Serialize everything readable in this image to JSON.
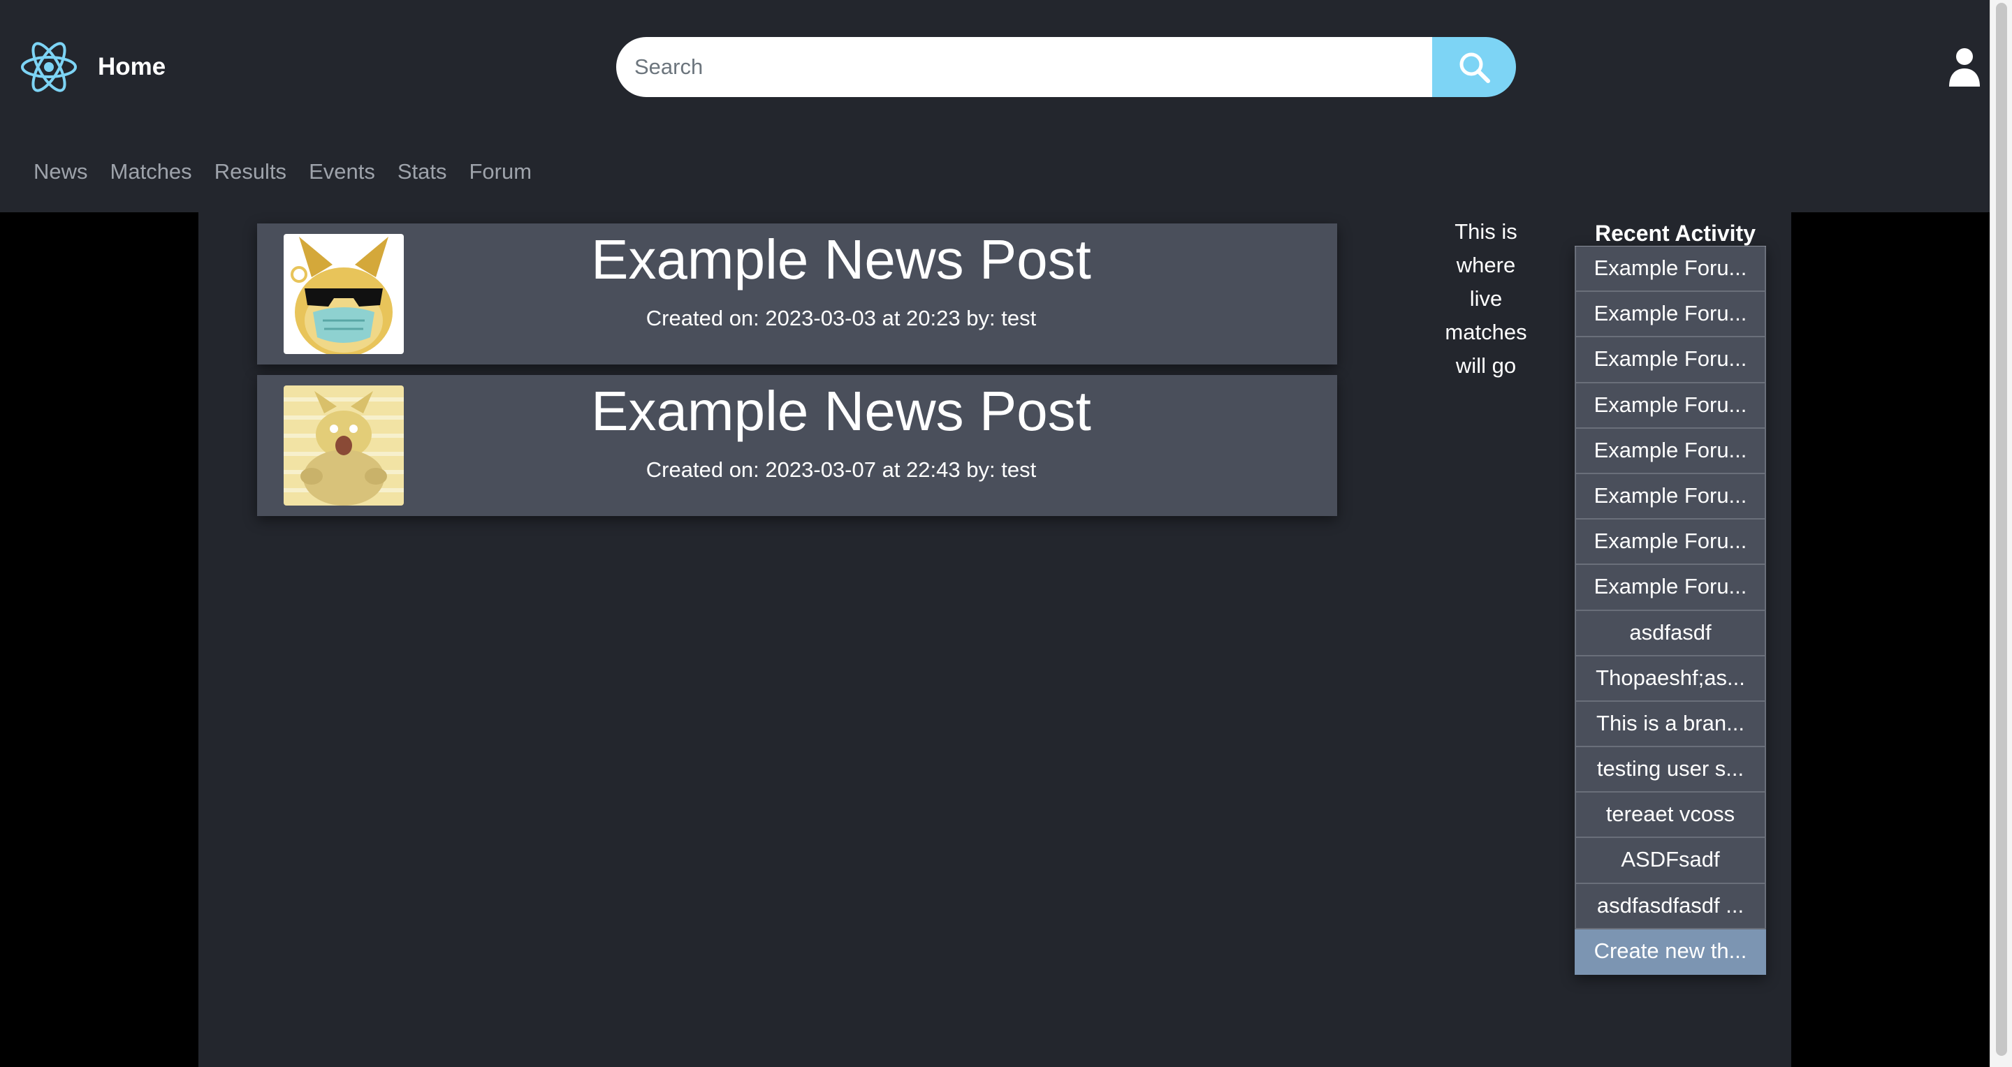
{
  "header": {
    "logo_icon": "react-atom-icon",
    "title": "Home",
    "search": {
      "placeholder": "Search",
      "value": "",
      "button_icon": "search-icon"
    },
    "user_icon": "user-icon"
  },
  "nav": {
    "items": [
      {
        "label": "News"
      },
      {
        "label": "Matches"
      },
      {
        "label": "Results"
      },
      {
        "label": "Events"
      },
      {
        "label": "Stats"
      },
      {
        "label": "Forum"
      }
    ]
  },
  "posts": [
    {
      "title": "Example News Post",
      "meta": "Created on: 2023-03-03 at 20:23 by: test",
      "thumbnail": "sunglasses-mask-creature-image"
    },
    {
      "title": "Example News Post",
      "meta": "Created on: 2023-03-07 at 22:43 by: test",
      "thumbnail": "shocked-creature-image"
    }
  ],
  "live_matches": {
    "lines": [
      "This is",
      "where",
      "live",
      "matches",
      "will go"
    ]
  },
  "recent_activity": {
    "title": "Recent Activity",
    "items": [
      {
        "label": "Example Foru..."
      },
      {
        "label": "Example Foru..."
      },
      {
        "label": "Example Foru..."
      },
      {
        "label": "Example Foru..."
      },
      {
        "label": "Example Foru..."
      },
      {
        "label": "Example Foru..."
      },
      {
        "label": "Example Foru..."
      },
      {
        "label": "Example Foru..."
      },
      {
        "label": "asdfasdf"
      },
      {
        "label": "Thopaeshf;as..."
      },
      {
        "label": "This is a bran..."
      },
      {
        "label": "testing user s..."
      },
      {
        "label": "tereaet vcoss"
      },
      {
        "label": "ASDFsadf"
      },
      {
        "label": "asdfasdfasdf ..."
      }
    ],
    "create_label": "Create new th..."
  },
  "colors": {
    "background": "#23262d",
    "page_outer": "#000000",
    "card": "#4a4f5b",
    "accent": "#7dd4f5",
    "create_button": "#7c95b2",
    "nav_text": "#9ea3ab"
  }
}
